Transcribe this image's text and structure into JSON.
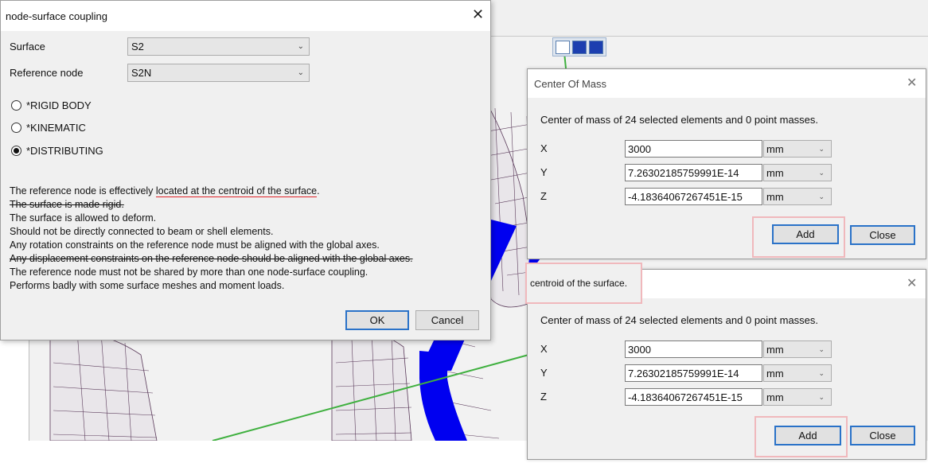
{
  "dialog": {
    "title": "node-surface coupling",
    "close_glyph": "✕",
    "surface_label": "Surface",
    "surface_value": "S2",
    "reference_label": "Reference node",
    "reference_value": "S2N",
    "options": [
      {
        "label": "*RIGID BODY",
        "checked": false
      },
      {
        "label": "*KINEMATIC",
        "checked": false
      },
      {
        "label": "*DISTRIBUTING",
        "checked": true
      }
    ],
    "notes": {
      "line1_prefix": "The reference node is effectively ",
      "line1_highlight": "located at the centroid of the surface",
      "line1_suffix": ".",
      "line2": "The surface is made rigid.",
      "line3": "The surface is allowed to deform.",
      "line4": "Should not be directly connected to beam or shell elements.",
      "line5": "Any rotation constraints on the reference node must be aligned with the global axes.",
      "line6": "Any displacement constraints on the reference node should be aligned with the global axes.",
      "line7": "The reference node must not be shared by more than one node-surface coupling.",
      "line8": "Performs badly with some surface meshes and moment loads."
    },
    "ok_label": "OK",
    "cancel_label": "Cancel"
  },
  "com1": {
    "title": "Center Of Mass",
    "close_glyph": "✕",
    "summary": "Center of mass of 24 selected elements and 0 point masses.",
    "rows": [
      {
        "axis": "X",
        "value": "3000",
        "unit": "mm"
      },
      {
        "axis": "Y",
        "value": "7.26302185759991E-14",
        "unit": "mm"
      },
      {
        "axis": "Z",
        "value": "-4.18364067267451E-15",
        "unit": "mm"
      }
    ],
    "add_label": "Add",
    "close_label": "Close"
  },
  "com2": {
    "title": "centroid of the surface.",
    "close_glyph": "✕",
    "summary": "Center of mass of 24 selected elements and 0 point masses.",
    "rows": [
      {
        "axis": "X",
        "value": "3000",
        "unit": "mm"
      },
      {
        "axis": "Y",
        "value": "7.26302185759991E-14",
        "unit": "mm"
      },
      {
        "axis": "Z",
        "value": "-4.18364067267451E-15",
        "unit": "mm"
      }
    ],
    "add_label": "Add",
    "close_label": "Close"
  },
  "colors": {
    "beam": "#0000f0",
    "axis_line": "#3fb03f",
    "mesh": "#5a3a5a",
    "highlight": "#f0b8bc"
  },
  "icons": [
    "close-icon",
    "chevron-down-icon",
    "view-wireframe-icon",
    "view-shaded-icon",
    "view-solid-icon"
  ]
}
